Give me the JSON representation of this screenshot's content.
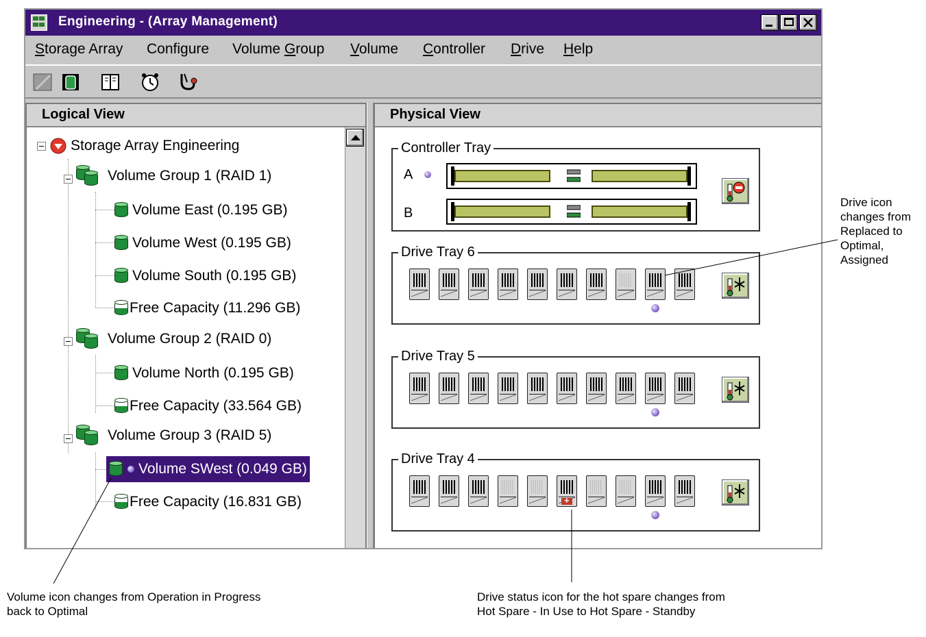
{
  "window": {
    "title": "Engineering - (Array Management)",
    "controls": [
      "minimize-icon",
      "maximize-icon",
      "close-icon"
    ]
  },
  "menu": [
    {
      "pre": "",
      "u": "S",
      "post": "torage Array"
    },
    {
      "pre": "Confi",
      "u": "g",
      "post": "ure"
    },
    {
      "pre": "Volume ",
      "u": "G",
      "post": "roup"
    },
    {
      "pre": "",
      "u": "V",
      "post": "olume"
    },
    {
      "pre": "",
      "u": "C",
      "post": "ontroller"
    },
    {
      "pre": "",
      "u": "D",
      "post": "rive"
    },
    {
      "pre": "",
      "u": "H",
      "post": "elp"
    }
  ],
  "toolbar": {
    "buttons": [
      "create-array-icon",
      "volume-icon",
      "book-icon",
      "clock-icon",
      "stethoscope-icon"
    ]
  },
  "logical_view": {
    "header": "Logical View",
    "root": "Storage Array Engineering",
    "groups": [
      {
        "label": "Volume Group 1 (RAID 1)",
        "volumes": [
          "Volume East  (0.195 GB)",
          "Volume West  (0.195 GB)",
          "Volume South (0.195 GB)"
        ],
        "free": "Free Capacity (11.296 GB)"
      },
      {
        "label": "Volume Group 2 (RAID 0)",
        "volumes": [
          "Volume North  (0.195 GB)"
        ],
        "free": "Free Capacity (33.564 GB)"
      },
      {
        "label": "Volume Group 3 (RAID 5)",
        "volumes": [
          "Volume SWest  (0.049 GB)"
        ],
        "free": "Free Capacity (16.831 GB)"
      }
    ]
  },
  "physical_view": {
    "header": "Physical View",
    "controller_tray": {
      "title": "Controller Tray",
      "controllers": [
        "A",
        "B"
      ]
    },
    "drive_trays": [
      {
        "title": "Drive Tray 6",
        "drive_count": 10,
        "empty_slots": [
          8
        ],
        "hot_spare_slot": null,
        "status_dot_slot": 9
      },
      {
        "title": "Drive Tray 5",
        "drive_count": 10,
        "empty_slots": [],
        "hot_spare_slot": null,
        "status_dot_slot": 9
      },
      {
        "title": "Drive Tray 4",
        "drive_count": 10,
        "empty_slots": [
          4,
          5,
          7,
          8
        ],
        "hot_spare_slot": 6,
        "status_dot_slot": 9
      }
    ]
  },
  "annotations": {
    "drive_icon": "Drive icon changes from Replaced to Optimal, Assigned",
    "volume_icon": "Volume icon changes from Operation in Progress back to Optimal",
    "hot_spare": "Drive status icon for the hot spare changes from Hot Spare - In Use to Hot Spare - Standby"
  }
}
